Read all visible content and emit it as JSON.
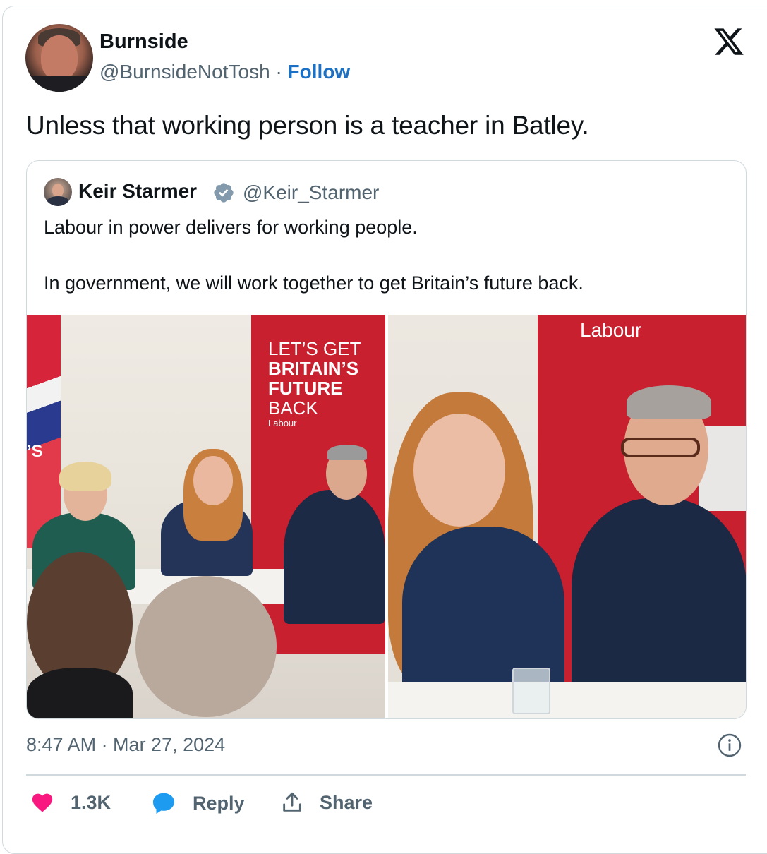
{
  "author": {
    "name": "Burnside",
    "handle": "@BurnsideNotTosh",
    "separator": "·",
    "follow_label": "Follow"
  },
  "tweet": {
    "text": "Unless that working person is a teacher in Batley."
  },
  "quoted": {
    "name": "Keir Starmer",
    "handle": "@Keir_Starmer",
    "line1": "Labour in power delivers for working people.",
    "line2": "In government, we will work together to get Britain’s future back.",
    "photo_left": {
      "banner_line1": "LET’S GET",
      "banner_line2": "BRITAIN’S",
      "banner_line3": "FUTURE",
      "banner_line4": "BACK",
      "banner_brand": "Labour",
      "edge_text": "’S"
    },
    "photo_right": {
      "banner_brand": "Labour"
    }
  },
  "meta": {
    "timestamp": "8:47 AM · Mar 27, 2024"
  },
  "actions": {
    "likes": "1.3K",
    "reply_label": "Reply",
    "share_label": "Share"
  },
  "colors": {
    "follow": "#1d71c5",
    "heart": "#f91880",
    "reply_bubble": "#1d9bf0",
    "verified": "#829aab",
    "labour_red": "#c8202f"
  },
  "icons": {
    "brand": "x-logo-icon",
    "verified": "verified-badge-icon",
    "info": "info-icon",
    "like": "heart-icon",
    "reply": "speech-bubble-icon",
    "share": "share-icon"
  }
}
